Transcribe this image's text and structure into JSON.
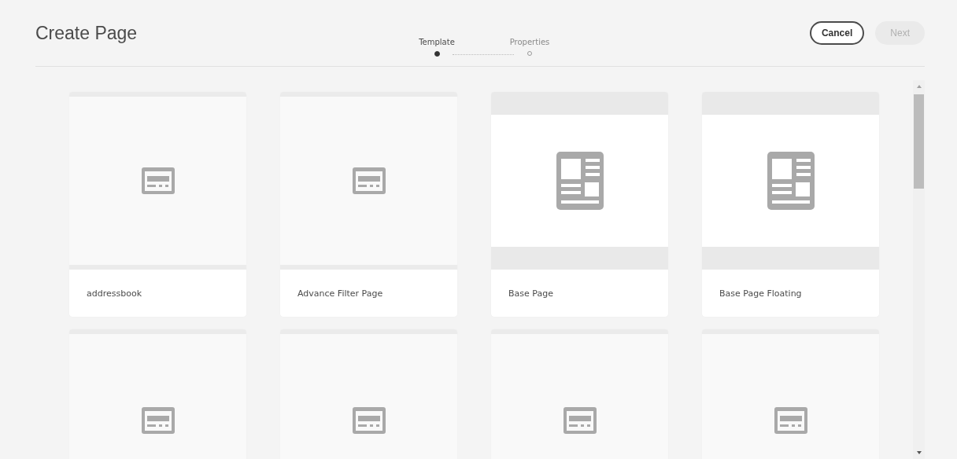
{
  "header": {
    "title": "Create Page"
  },
  "steps": [
    {
      "label": "Template",
      "selected": true
    },
    {
      "label": "Properties",
      "selected": false
    }
  ],
  "buttons": [
    {
      "label": "Cancel",
      "disabled": false
    },
    {
      "label": "Next",
      "disabled": true
    }
  ],
  "templates": [
    {
      "kind": "form",
      "label": "addressbook"
    },
    {
      "kind": "form",
      "label": "Advance Filter Page"
    },
    {
      "kind": "layout",
      "label": "Base Page"
    },
    {
      "kind": "layout",
      "label": "Base Page Floating"
    },
    {
      "kind": "form"
    },
    {
      "kind": "form"
    },
    {
      "kind": "form"
    },
    {
      "kind": "form"
    }
  ]
}
